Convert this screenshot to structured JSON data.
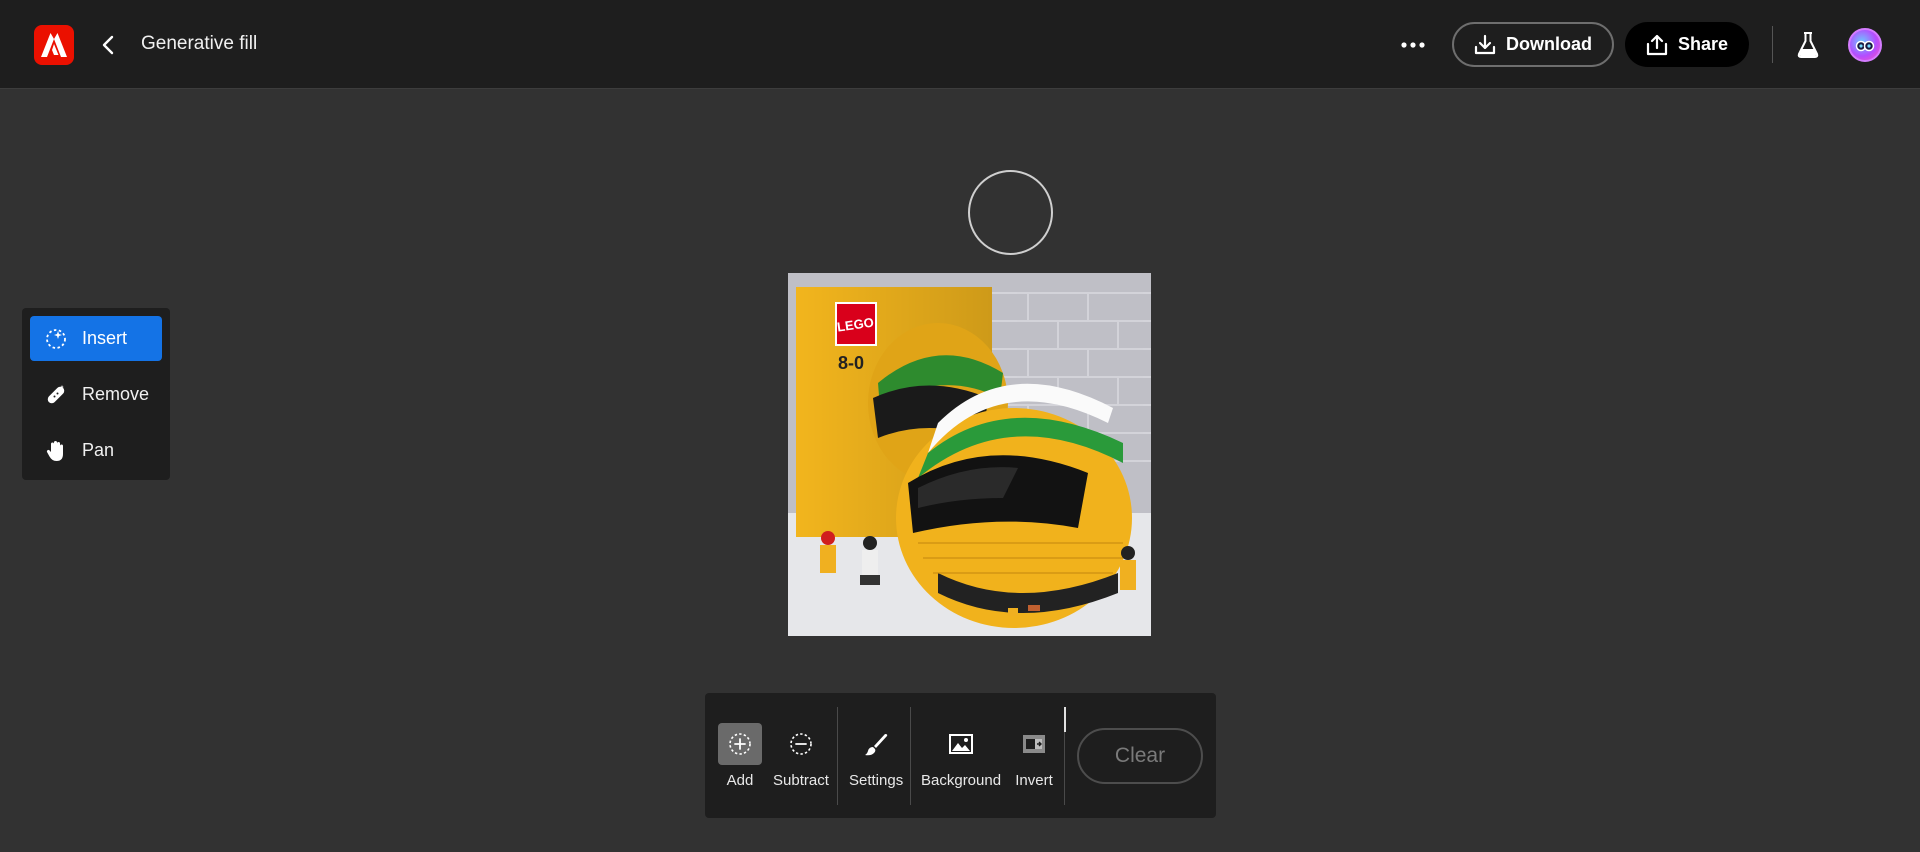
{
  "header": {
    "title": "Generative fill",
    "download_label": "Download",
    "share_label": "Share"
  },
  "tools": [
    {
      "label": "Insert",
      "icon": "insert-sparkle-icon",
      "active": true
    },
    {
      "label": "Remove",
      "icon": "remove-bandage-icon",
      "active": false
    },
    {
      "label": "Pan",
      "icon": "hand-icon",
      "active": false
    }
  ],
  "toolbar": {
    "add_label": "Add",
    "subtract_label": "Subtract",
    "settings_label": "Settings",
    "background_label": "Background",
    "invert_label": "Invert",
    "clear_label": "Clear"
  },
  "canvas": {
    "box_brand": "LEGO",
    "box_number": "8-0"
  },
  "colors": {
    "accent": "#1473e6",
    "brand": "#eb1000",
    "background": "#323232",
    "panel": "#1e1e1e"
  }
}
